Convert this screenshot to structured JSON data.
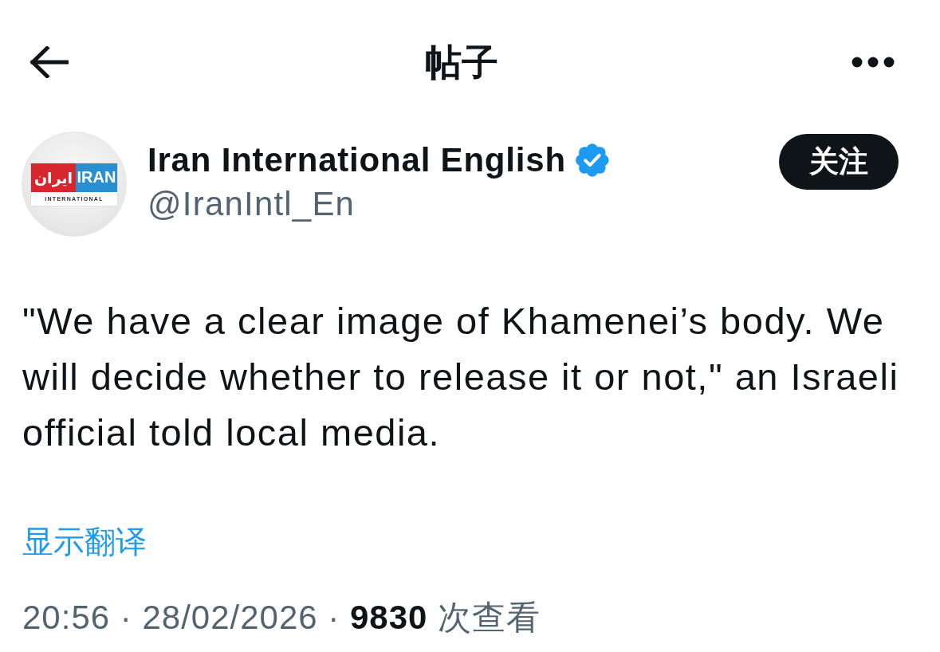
{
  "top_bar": {
    "title": "帖子"
  },
  "author": {
    "name": "Iran International English",
    "verified": true,
    "handle": "@IranIntl_En",
    "avatar": {
      "logo_persian": "ایران",
      "logo_latin": "IRAN",
      "logo_subtitle": "INTERNATIONAL"
    }
  },
  "follow_button": {
    "label": "关注"
  },
  "post": {
    "text": "\"We have a clear image of Khamenei’s body. We will decide whether to release it or not,\" an Israeli official told local media.",
    "translate_link": "显示翻译",
    "meta": "20:56 · 28/02/2026 · **9830** 次查看"
  }
}
